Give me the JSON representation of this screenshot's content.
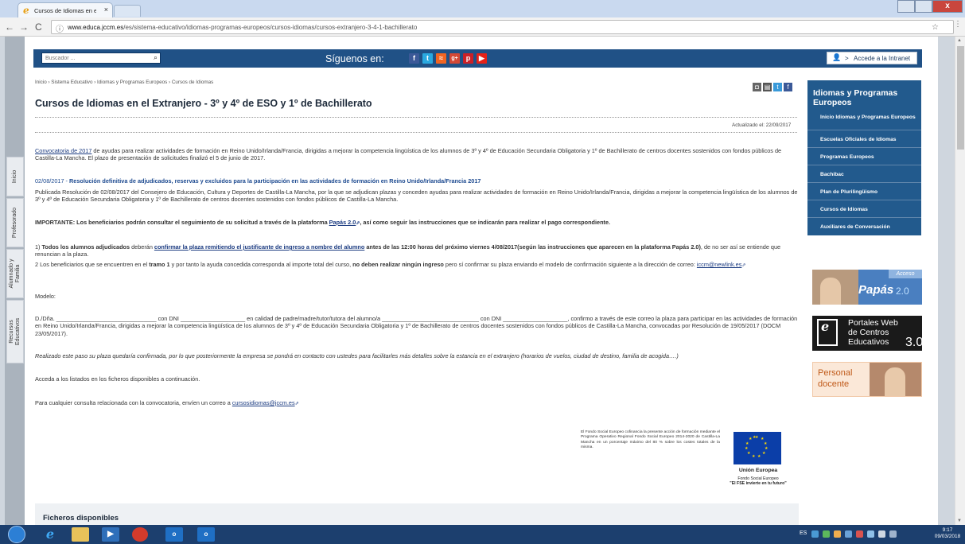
{
  "browser": {
    "tab_title": "Cursos de Idiomas en el",
    "tab_close": "×",
    "url_host": "www.educa.jccm.es",
    "url_path": "/es/sistema-educativo/idiomas-programas-europeos/cursos-idiomas/cursos-extranjero-3-4-1-bachillerato",
    "window_close": "x"
  },
  "header": {
    "search_placeholder": "Buscador ...",
    "siguenos": "Síguenos en:",
    "intranet": "Accede a la Intranet",
    "intranet_arrow": ">"
  },
  "left_tabs": [
    "Inicio",
    "Profesorado",
    "Alumnado y Familia",
    "Recursos Educativos"
  ],
  "breadcrumb": "Inicio › Sistema Educativo › Idiomas y Programas Europeos › Cursos de Idiomas",
  "title": "Cursos de Idiomas en el Extranjero - 3º y 4º de ESO y 1º de Bachillerato",
  "updated": "Actualizado el: 22/09/2017",
  "p1": {
    "link": "Convocatoria de 2017",
    "text": " de ayudas para realizar actividades de formación en Reino Unido/Irlanda/Francia, dirigidas a mejorar la competencia lingüística de los alumnos de 3º y 4º de Educación Secundaria Obligatoria y 1º de Bachillerato de centros docentes sostenidos con fondos públicos de Castilla-La Mancha. El plazo de presentación de solicitudes finalizó el 5 de junio de 2017."
  },
  "section": {
    "date": "02/08/2017 - ",
    "heading": "Resolución definitiva de adjudicados, reservas y excluidos para la participación en las actividades de formación en Reino Unido/Irlanda/Francia 2017",
    "text": "Publicada Resolución de 02/08/2017 del Consejero de Educación, Cultura y Deportes de Castilla-La Mancha, por la que se adjudican plazas y conceden ayudas para realizar actividades de formación en Reino Unido/Irlanda/Francia, dirigidas a mejorar la competencia lingüística de los alumnos de 3º y 4º de Educación Secundaria Obligatoria y 1º de Bachillerato de centros docentes sostenidos con fondos públicos de Castilla-La Mancha."
  },
  "importante": {
    "before": "IMPORTANTE: Los beneficiarios podrán consultar el seguimiento de su solicitud  a través de la plataforma ",
    "link": "Papás 2.0",
    "after": ", así como seguir las instrucciones que se indicarán para realizar el pago correspondiente."
  },
  "item1": {
    "num": "1) ",
    "b1": "Todos los alumnos adjudicados",
    "t1": " deberán ",
    "link": "confirmar la plaza remitiendo el justificante de ingreso a nombre del alumno",
    "b2": " antes de las 12:00 horas del próximo viernes 4/08/2017(según las instrucciones que aparecen en la plataforma Papás 2.0)",
    "t2": ", de no ser así se entiende que renuncian a la plaza."
  },
  "item2": {
    "t1": "2 Los beneficiarios que se encuentren en el ",
    "b1": "tramo 1",
    "t2": " y por tanto la ayuda concedida corresponda al importe total del curso, ",
    "b2": "no deben realizar ningún ingreso",
    "t3": " pero sí confirmar su plaza enviando el modelo de confirmación siguiente a la dirección de correo: ",
    "email": "iccm@newlink.es"
  },
  "modelo": "Modelo:",
  "modelo_text": "D./Dña. _______________________________ con DNI ____________________ en calidad de padre/madre/tutor/tutora del alumno/a ______________________________ con DNI ____________________, confirmo a través de este correo la plaza para participar en las actividades de formación en Reino Unido/Irlanda/Francia, dirigidas a mejorar la competencia lingüística de los alumnos de 3º y 4º de Educación Secundaria Obligatoria y 1º de Bachillerato de centros docentes sostenidos con fondos públicos de Castilla-La Mancha, convocadas por Resolución de 19/05/2017 (DOCM 23/05/2017).",
  "realizado": "Realizado este paso su plaza quedaría confirmada, por lo que posteriormente la empresa se pondrá en contacto con ustedes para facilitarles más detalles sobre la estancia en el extranjero (horarios de vuelos, ciudad de destino, familia de acogida….)",
  "acceda": "Acceda a los listados en los ficheros disponibles a continuación.",
  "consulta": {
    "text": "Para cualquier consulta relacionada con la convocatoria, envíen un correo a ",
    "email": "cursosidiomas@jccm.es"
  },
  "fse_text": "El Fondo Social Europeo cofinancia la presente acción de formación mediante el Programa Operativo Regional Fondo Social Europeo 2014-2020 de Castilla-La Mancha en un porcentaje máximo del 80 % sobre los costes totales de la misma.",
  "eu": {
    "name": "Unión Europea",
    "sub1": "Fondo Social Europeo",
    "sub2": "\"El FSE invierte en tu futuro\""
  },
  "files_title": "Ficheros disponibles",
  "sidebar": {
    "title": "Idiomas y Programas Europeos",
    "items": [
      "Inicio Idiomas y Programas Europeos",
      "Escuelas Oficiales de Idiomas",
      "Programas Europeos",
      "Bachibac",
      "Plan de Plurilingüismo",
      "Cursos de Idiomas",
      "Auxiliares de Conversación"
    ]
  },
  "banners": {
    "acceso": "Acceso",
    "papas": "Papás",
    "papas_ver": "2.0",
    "portales_l1": "Portales Web",
    "portales_l2": "de Centros",
    "portales_l3": "Educativos",
    "portales_ver": "3.0",
    "personal_l1": "Personal",
    "personal_l2": "docente"
  },
  "taskbar": {
    "lang": "ES",
    "time": "9:17",
    "date": "09/03/2018"
  },
  "colors": {
    "header_blue": "#205186",
    "sidebar_blue": "#225a8d",
    "link_blue": "#1a3a80"
  }
}
